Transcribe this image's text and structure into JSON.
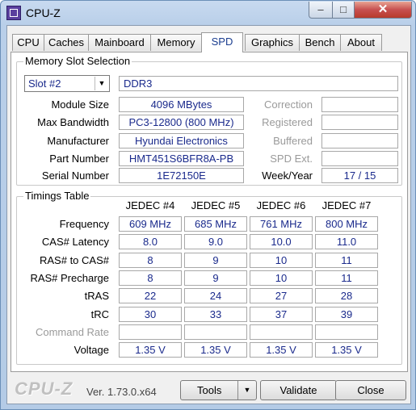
{
  "window": {
    "title": "CPU-Z",
    "caption_buttons": {
      "minimize": "–",
      "maximize": "□",
      "close": "✕"
    }
  },
  "tabs": [
    "CPU",
    "Caches",
    "Mainboard",
    "Memory",
    "SPD",
    "Graphics",
    "Bench",
    "About"
  ],
  "active_tab": "SPD",
  "slot_group": {
    "title": "Memory Slot Selection",
    "slot": "Slot #2",
    "type": "DDR3",
    "labels": {
      "module_size": "Module Size",
      "max_bandwidth": "Max Bandwidth",
      "manufacturer": "Manufacturer",
      "part_number": "Part Number",
      "serial_number": "Serial Number",
      "correction": "Correction",
      "registered": "Registered",
      "buffered": "Buffered",
      "spd_ext": "SPD Ext.",
      "week_year": "Week/Year"
    },
    "values": {
      "module_size": "4096 MBytes",
      "max_bandwidth": "PC3-12800 (800 MHz)",
      "manufacturer": "Hyundai Electronics",
      "part_number": "HMT451S6BFR8A-PB",
      "serial_number": "1E72150E",
      "correction": "",
      "registered": "",
      "buffered": "",
      "spd_ext": "",
      "week_year": "17 / 15"
    }
  },
  "timings": {
    "title": "Timings Table",
    "columns": [
      "JEDEC #4",
      "JEDEC #5",
      "JEDEC #6",
      "JEDEC #7"
    ],
    "rows": [
      {
        "label": "Frequency",
        "values": [
          "609 MHz",
          "685 MHz",
          "761 MHz",
          "800 MHz"
        ]
      },
      {
        "label": "CAS# Latency",
        "values": [
          "8.0",
          "9.0",
          "10.0",
          "11.0"
        ]
      },
      {
        "label": "RAS# to CAS#",
        "values": [
          "8",
          "9",
          "10",
          "11"
        ]
      },
      {
        "label": "RAS# Precharge",
        "values": [
          "8",
          "9",
          "10",
          "11"
        ]
      },
      {
        "label": "tRAS",
        "values": [
          "22",
          "24",
          "27",
          "28"
        ]
      },
      {
        "label": "tRC",
        "values": [
          "30",
          "33",
          "37",
          "39"
        ]
      },
      {
        "label": "Command Rate",
        "values": [
          "",
          "",
          "",
          ""
        ]
      },
      {
        "label": "Voltage",
        "values": [
          "1.35 V",
          "1.35 V",
          "1.35 V",
          "1.35 V"
        ]
      }
    ]
  },
  "footer": {
    "logo": "CPU-Z",
    "version": "Ver. 1.73.0.x64",
    "tools": "Tools",
    "validate": "Validate",
    "close": "Close"
  }
}
